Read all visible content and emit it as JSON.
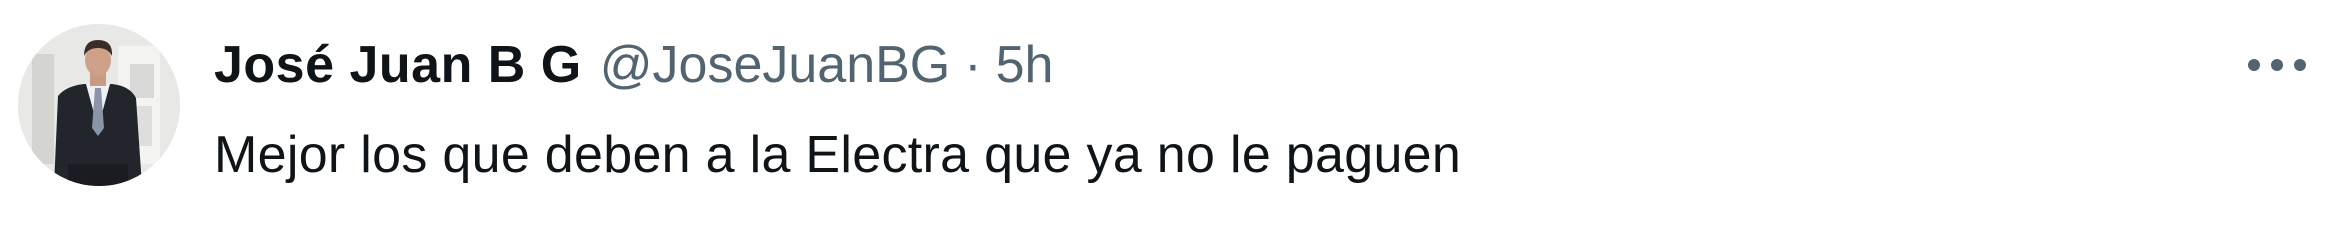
{
  "tweet": {
    "display_name": "José Juan B G",
    "handle": "@JoseJuanBG",
    "separator": "·",
    "time": "5h",
    "text": "Mejor los que deben a la Electra que ya no le paguen"
  },
  "icons": {
    "more": "more-horizontal-icon",
    "avatar": "user-avatar"
  },
  "colors": {
    "primary_text": "#0f1419",
    "secondary_text": "#536471",
    "background": "#ffffff"
  }
}
